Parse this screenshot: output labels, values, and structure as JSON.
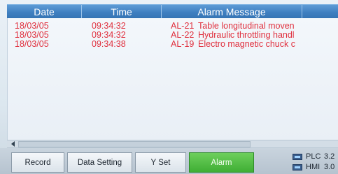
{
  "table": {
    "headers": {
      "date": "Date",
      "time": "Time",
      "message": "Alarm Message"
    },
    "rows": [
      {
        "date": "18/03/05",
        "time": "09:34:32",
        "code": "AL-21",
        "message": "Table longitudinal moven"
      },
      {
        "date": "18/03/05",
        "time": "09:34:32",
        "code": "AL-22",
        "message": "Hydraulic throttling handl"
      },
      {
        "date": "18/03/05",
        "time": "09:34:38",
        "code": "AL-19",
        "message": "Electro magnetic chuck c"
      }
    ]
  },
  "buttons": {
    "record": "Record",
    "data_setting": "Data Setting",
    "y_set": "Y Set",
    "alarm": "Alarm"
  },
  "status": {
    "plc_label": "PLC",
    "plc_version": "3.2",
    "hmi_label": "HMI",
    "hmi_version": "3.0"
  },
  "colors": {
    "header_bg": "#3f7fc0",
    "alarm_text": "#e0303e",
    "alarm_button": "#3fae34"
  }
}
